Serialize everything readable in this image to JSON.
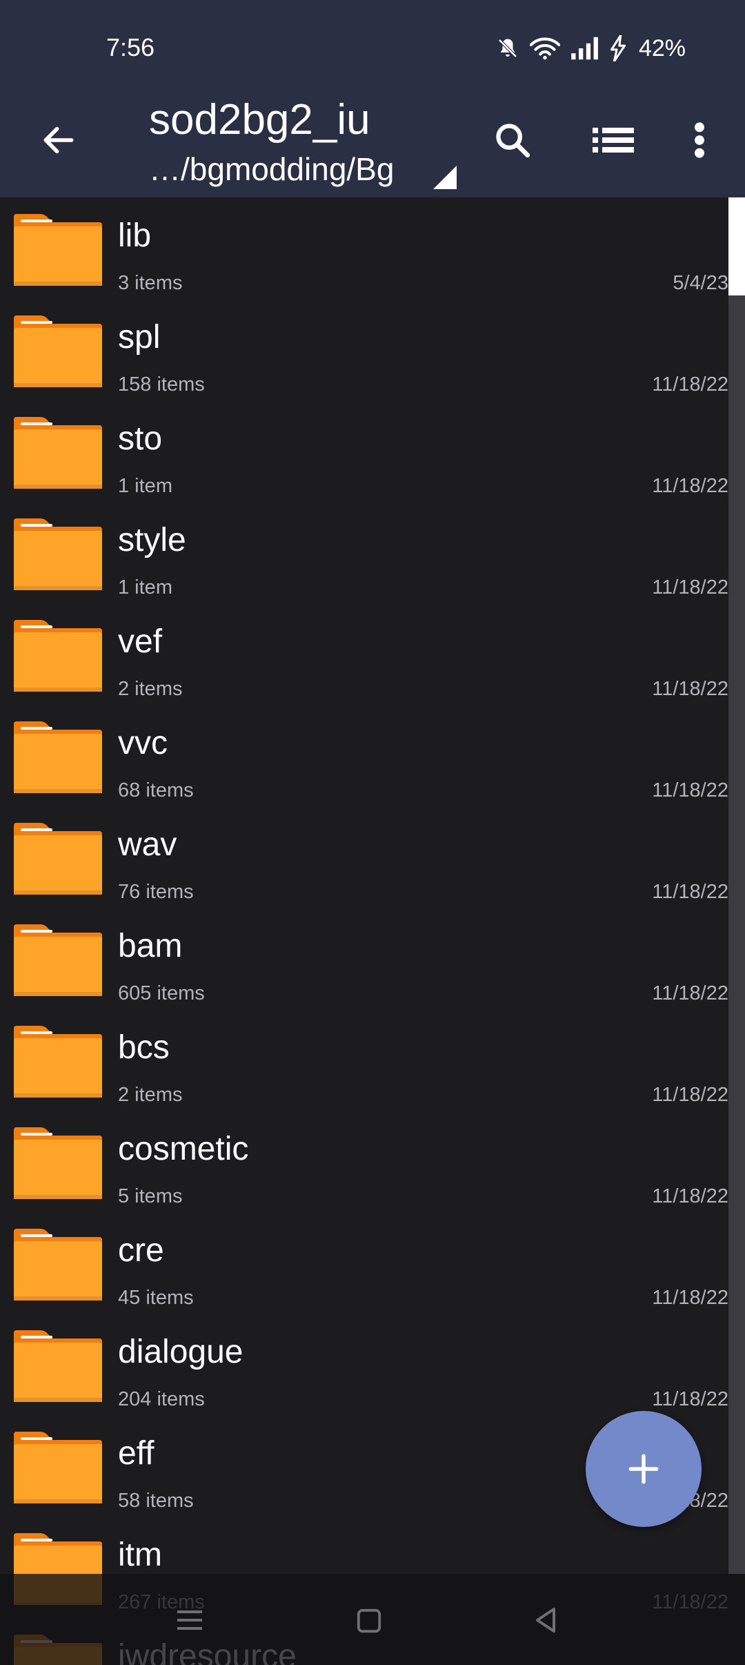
{
  "status_bar": {
    "time": "7:56",
    "battery": "42%",
    "icons": [
      "mute-icon",
      "wifi-icon",
      "signal-icon",
      "charging-icon"
    ]
  },
  "toolbar": {
    "title": "sod2bg2_iu",
    "path": "…/bgmodding/Bg",
    "back_icon": "arrow-left",
    "search_icon": "search",
    "view_icon": "list-view",
    "more_icon": "more-vertical"
  },
  "colors": {
    "toolbar_bg": "#2a2f44",
    "list_bg": "#1c1c1f",
    "folder": "#fea429",
    "folder_tab": "#f07e10",
    "fab": "#7389c9"
  },
  "files": [
    {
      "name": "lib",
      "count": "3 items",
      "date": "5/4/23"
    },
    {
      "name": "spl",
      "count": "158 items",
      "date": "11/18/22"
    },
    {
      "name": "sto",
      "count": "1 item",
      "date": "11/18/22"
    },
    {
      "name": "style",
      "count": "1 item",
      "date": "11/18/22"
    },
    {
      "name": "vef",
      "count": "2 items",
      "date": "11/18/22"
    },
    {
      "name": "vvc",
      "count": "68 items",
      "date": "11/18/22"
    },
    {
      "name": "wav",
      "count": "76 items",
      "date": "11/18/22"
    },
    {
      "name": "bam",
      "count": "605 items",
      "date": "11/18/22"
    },
    {
      "name": "bcs",
      "count": "2 items",
      "date": "11/18/22"
    },
    {
      "name": "cosmetic",
      "count": "5 items",
      "date": "11/18/22"
    },
    {
      "name": "cre",
      "count": "45 items",
      "date": "11/18/22"
    },
    {
      "name": "dialogue",
      "count": "204 items",
      "date": "11/18/22"
    },
    {
      "name": "eff",
      "count": "58 items",
      "date": "11/18/22"
    },
    {
      "name": "itm",
      "count": "267 items",
      "date": "11/18/22"
    },
    {
      "name": "iwdresource",
      "count": "",
      "date": ""
    }
  ],
  "fab": {
    "icon": "plus"
  },
  "nav_bar": {
    "recents_icon": "recents",
    "home_icon": "home",
    "back_icon": "back"
  }
}
